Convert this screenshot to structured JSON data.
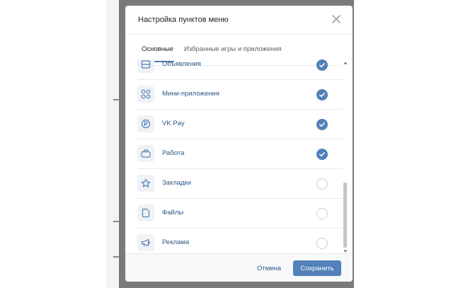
{
  "modal": {
    "title": "Настройка пунктов меню",
    "tabs": [
      {
        "label": "Основные",
        "active": true
      },
      {
        "label": "Избранные игры и приложения",
        "active": false
      }
    ],
    "items": [
      {
        "label": "Объявления",
        "icon": "classifieds-icon",
        "checked": true
      },
      {
        "label": "Мини-приложения",
        "icon": "mini-apps-icon",
        "checked": true
      },
      {
        "label": "VK Pay",
        "icon": "vk-pay-icon",
        "checked": true
      },
      {
        "label": "Работа",
        "icon": "briefcase-icon",
        "checked": true
      },
      {
        "label": "Закладки",
        "icon": "star-icon",
        "checked": false
      },
      {
        "label": "Файлы",
        "icon": "file-icon",
        "checked": false
      },
      {
        "label": "Реклама",
        "icon": "megaphone-icon",
        "checked": false
      }
    ],
    "footer": {
      "cancel_label": "Отмена",
      "save_label": "Сохранить"
    }
  },
  "colors": {
    "accent": "#5181b8",
    "link": "#2a5885",
    "divider": "#e7e8ec",
    "backdrop": "#7a7a7a"
  }
}
